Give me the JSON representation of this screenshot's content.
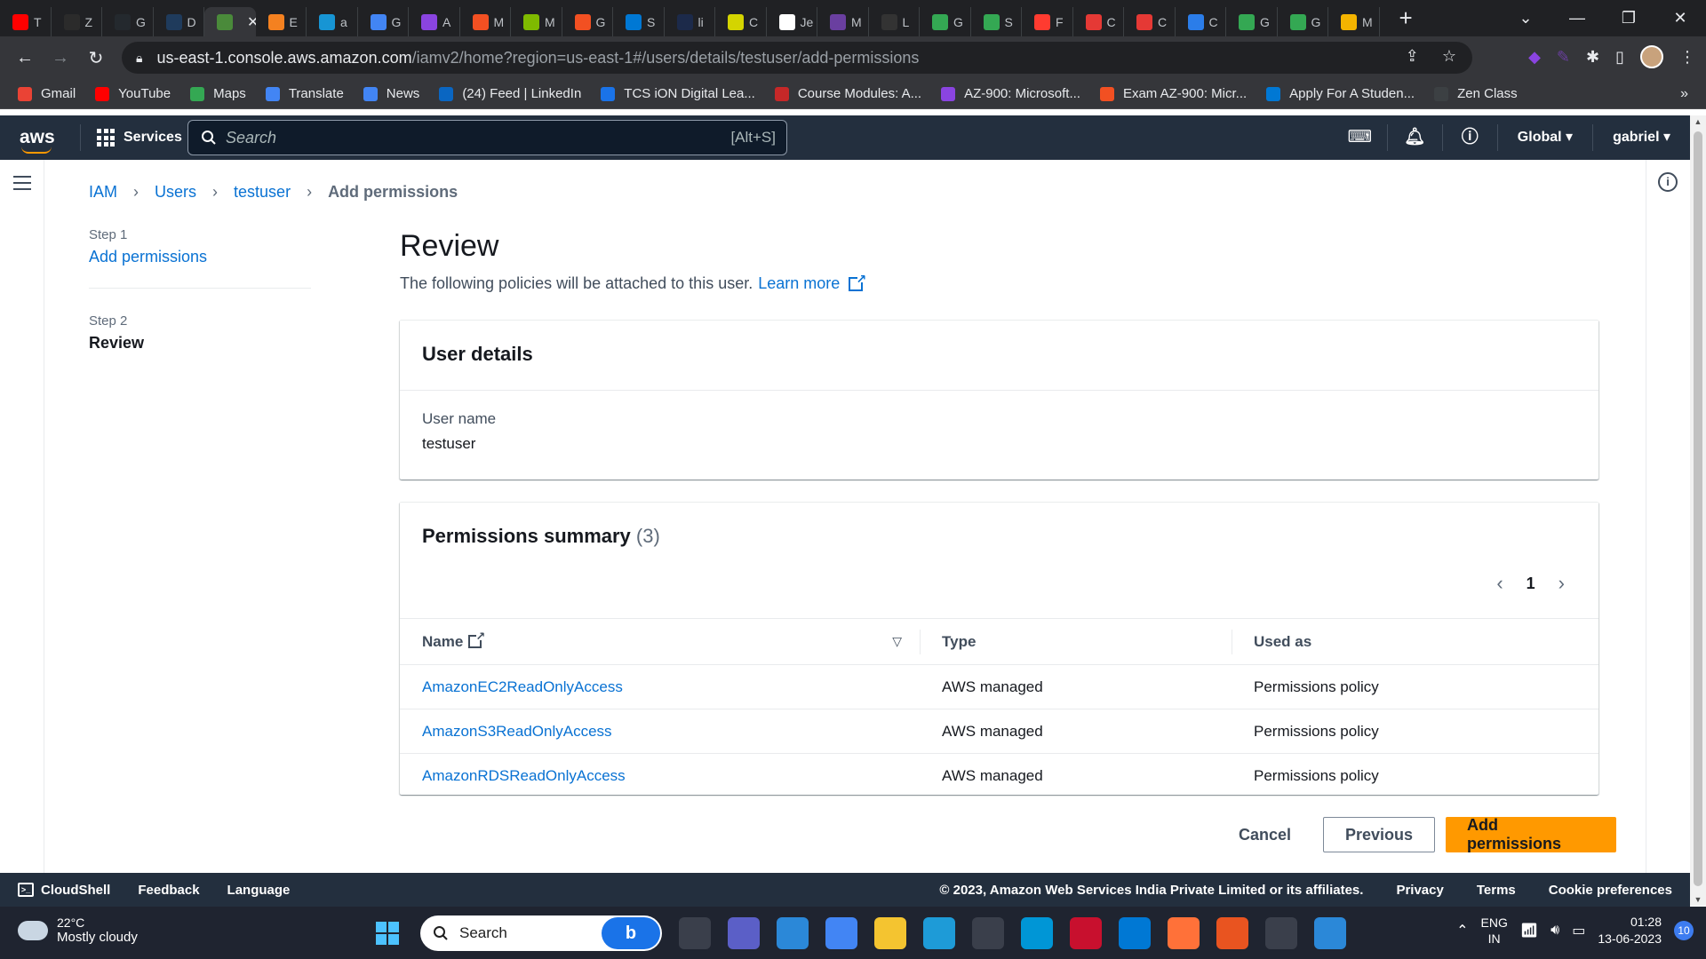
{
  "browser": {
    "tabs": [
      {
        "char": "T",
        "color": "#ff0000"
      },
      {
        "char": "Z",
        "color": "#2b2b2b"
      },
      {
        "char": "G",
        "color": "#24292e"
      },
      {
        "char": "D",
        "color": "#1f3b5c"
      },
      {
        "char": "",
        "color": "#4a8a3a",
        "active": true
      },
      {
        "char": "E",
        "color": "#f48120"
      },
      {
        "char": "a",
        "color": "#1795d4"
      },
      {
        "char": "G",
        "color": "#4285f4"
      },
      {
        "char": "A",
        "color": "#8a44e0"
      },
      {
        "char": "M",
        "color": "#f25022"
      },
      {
        "char": "M",
        "color": "#7fba00"
      },
      {
        "char": "G",
        "color": "#f25022"
      },
      {
        "char": "S",
        "color": "#0078d4"
      },
      {
        "char": "li",
        "color": "#1c2a4a"
      },
      {
        "char": "C",
        "color": "#d4d400"
      },
      {
        "char": "Je",
        "color": "#ffffff"
      },
      {
        "char": "M",
        "color": "#6a3fa0"
      },
      {
        "char": "L",
        "color": "#333333"
      },
      {
        "char": "G",
        "color": "#34a853"
      },
      {
        "char": "S",
        "color": "#34a853"
      },
      {
        "char": "F",
        "color": "#ff3b30"
      },
      {
        "char": "C",
        "color": "#e53935"
      },
      {
        "char": "C",
        "color": "#e53935"
      },
      {
        "char": "C",
        "color": "#2b7de9"
      },
      {
        "char": "G",
        "color": "#34a853"
      },
      {
        "char": "G",
        "color": "#34a853"
      },
      {
        "char": "M",
        "color": "#f4b400"
      }
    ],
    "active_tab_close": "✕",
    "new_tab": "+",
    "url_host": "us-east-1.console.aws.amazon.com",
    "url_path": "/iamv2/home?region=us-east-1#/users/details/testuser/add-permissions",
    "bookmarks": [
      {
        "label": "Gmail",
        "color": "#ea4335"
      },
      {
        "label": "YouTube",
        "color": "#ff0000"
      },
      {
        "label": "Maps",
        "color": "#34a853"
      },
      {
        "label": "Translate",
        "color": "#4285f4"
      },
      {
        "label": "News",
        "color": "#4285f4"
      },
      {
        "label": "(24) Feed | LinkedIn",
        "color": "#0a66c2"
      },
      {
        "label": "TCS iON Digital Lea...",
        "color": "#1a73e8"
      },
      {
        "label": "Course Modules: A...",
        "color": "#c62828"
      },
      {
        "label": "AZ-900: Microsoft...",
        "color": "#8a44e0"
      },
      {
        "label": "Exam AZ-900: Micr...",
        "color": "#f25022"
      },
      {
        "label": "Apply For A Studen...",
        "color": "#0078d4"
      },
      {
        "label": "Zen Class",
        "color": "#3c4043"
      }
    ],
    "bookmarks_more": "»"
  },
  "aws": {
    "logo": "aws",
    "services_label": "Services",
    "search_placeholder": "Search",
    "search_shortcut": "[Alt+S]",
    "region": "Global ▾",
    "user": "gabriel ▾",
    "icons": [
      "cloudshell-icon",
      "bell-icon",
      "help-icon"
    ]
  },
  "breadcrumb": {
    "items": [
      "IAM",
      "Users",
      "testuser"
    ],
    "current": "Add permissions"
  },
  "steps": [
    {
      "num": "Step 1",
      "label": "Add permissions",
      "state": "link"
    },
    {
      "num": "Step 2",
      "label": "Review",
      "state": "current"
    }
  ],
  "page": {
    "title": "Review",
    "description": "The following policies will be attached to this user.",
    "learn_more": "Learn more"
  },
  "user_details": {
    "title": "User details",
    "field_label": "User name",
    "field_value": "testuser"
  },
  "permissions": {
    "title": "Permissions summary",
    "count": "(3)",
    "page": "1",
    "prev": "‹",
    "next": "›",
    "columns": [
      "Name",
      "Type",
      "Used as"
    ],
    "rows": [
      {
        "name": "AmazonEC2ReadOnlyAccess",
        "type": "AWS managed",
        "used_as": "Permissions policy"
      },
      {
        "name": "AmazonS3ReadOnlyAccess",
        "type": "AWS managed",
        "used_as": "Permissions policy"
      },
      {
        "name": "AmazonRDSReadOnlyAccess",
        "type": "AWS managed",
        "used_as": "Permissions policy"
      }
    ]
  },
  "actions": {
    "cancel": "Cancel",
    "previous": "Previous",
    "submit": "Add permissions"
  },
  "footer": {
    "cloudshell": "CloudShell",
    "feedback": "Feedback",
    "language": "Language",
    "copyright": "© 2023, Amazon Web Services India Private Limited or its affiliates.",
    "privacy": "Privacy",
    "terms": "Terms",
    "cookies": "Cookie preferences"
  },
  "taskbar": {
    "temp": "22°C",
    "weather": "Mostly cloudy",
    "search": "Search",
    "lang1": "ENG",
    "lang2": "IN",
    "time": "01:28",
    "date": "13-06-2023",
    "notif_count": "10",
    "apps": [
      {
        "name": "widgets-icon",
        "color": "#3a3f4b"
      },
      {
        "name": "chat-icon",
        "color": "#5b5fc7"
      },
      {
        "name": "settings-app-icon",
        "color": "#2b88d8"
      },
      {
        "name": "chrome-icon",
        "color": "#4285f4"
      },
      {
        "name": "file-explorer-icon",
        "color": "#f4c430"
      },
      {
        "name": "edge-icon",
        "color": "#1e9bd7"
      },
      {
        "name": "store-icon",
        "color": "#3a3f4b"
      },
      {
        "name": "myhp-icon",
        "color": "#0096d6"
      },
      {
        "name": "mcafee-icon",
        "color": "#c8102e"
      },
      {
        "name": "mail-icon",
        "color": "#0078d4"
      },
      {
        "name": "firefox-icon",
        "color": "#ff7139"
      },
      {
        "name": "ubuntu-icon",
        "color": "#e95420"
      },
      {
        "name": "network-app-icon",
        "color": "#3a3f4b"
      },
      {
        "name": "photos-icon",
        "color": "#2b88d8"
      }
    ]
  }
}
